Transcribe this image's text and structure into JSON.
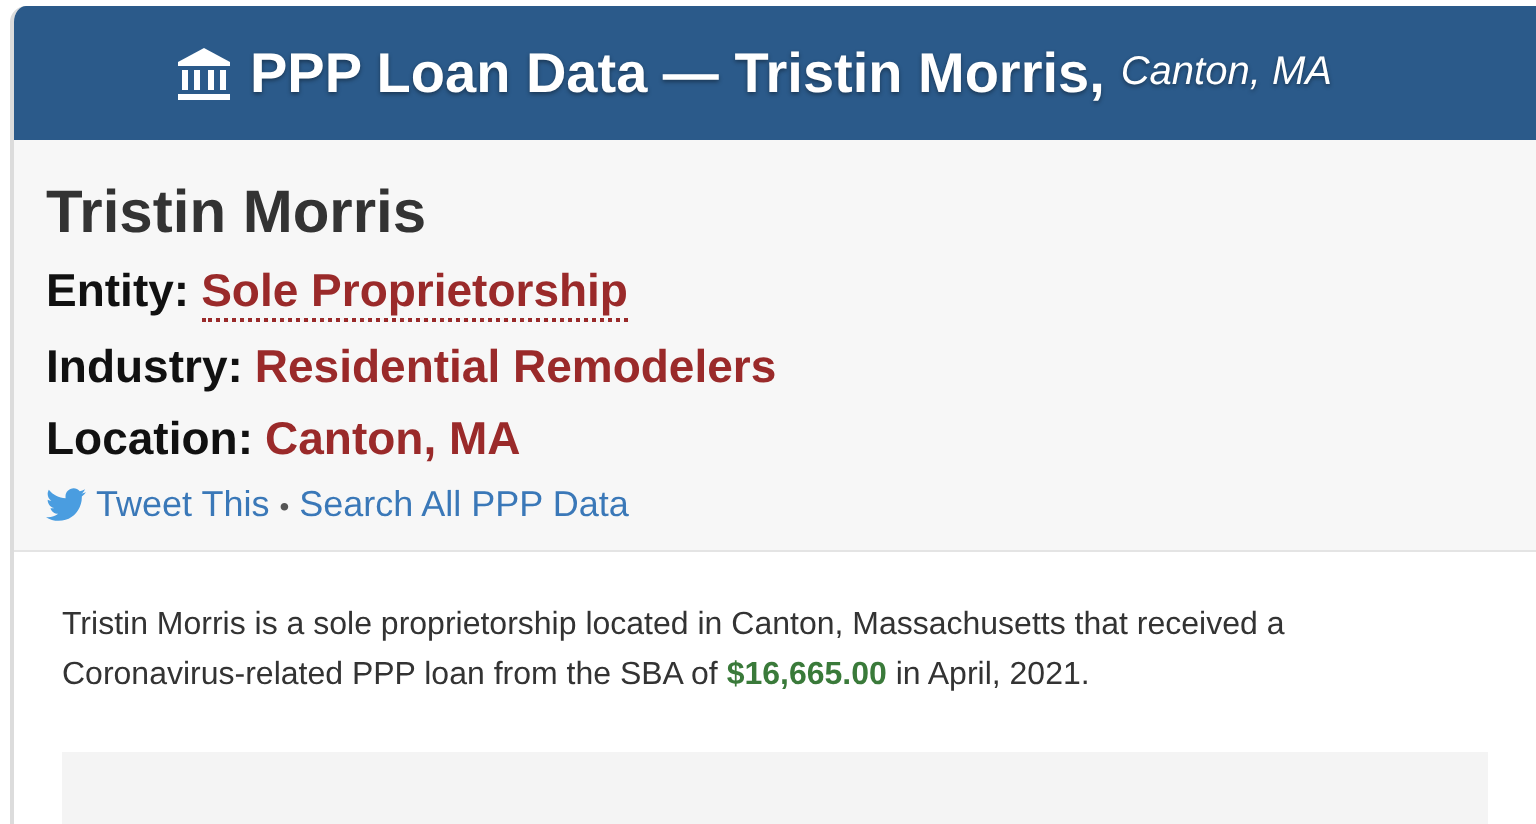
{
  "header": {
    "title": "PPP Loan Data — Tristin Morris,",
    "location": "Canton, MA"
  },
  "profile": {
    "name": "Tristin Morris",
    "fields": [
      {
        "label": "Entity:",
        "value": "Sole Proprietorship",
        "kind": "abbr"
      },
      {
        "label": "Industry:",
        "value": "Residential Remodelers",
        "kind": "plain"
      },
      {
        "label": "Location:",
        "value": "Canton, MA",
        "kind": "plain"
      }
    ],
    "links": {
      "tweet": "Tweet This",
      "separator": "•",
      "search": "Search All PPP Data"
    }
  },
  "summary": "Tristin Morris is a sole proprietorship located in Canton, Massachusetts that received a Coronavirus-related PPP loan from the SBA of **$16,665.00** in April, 2021."
}
